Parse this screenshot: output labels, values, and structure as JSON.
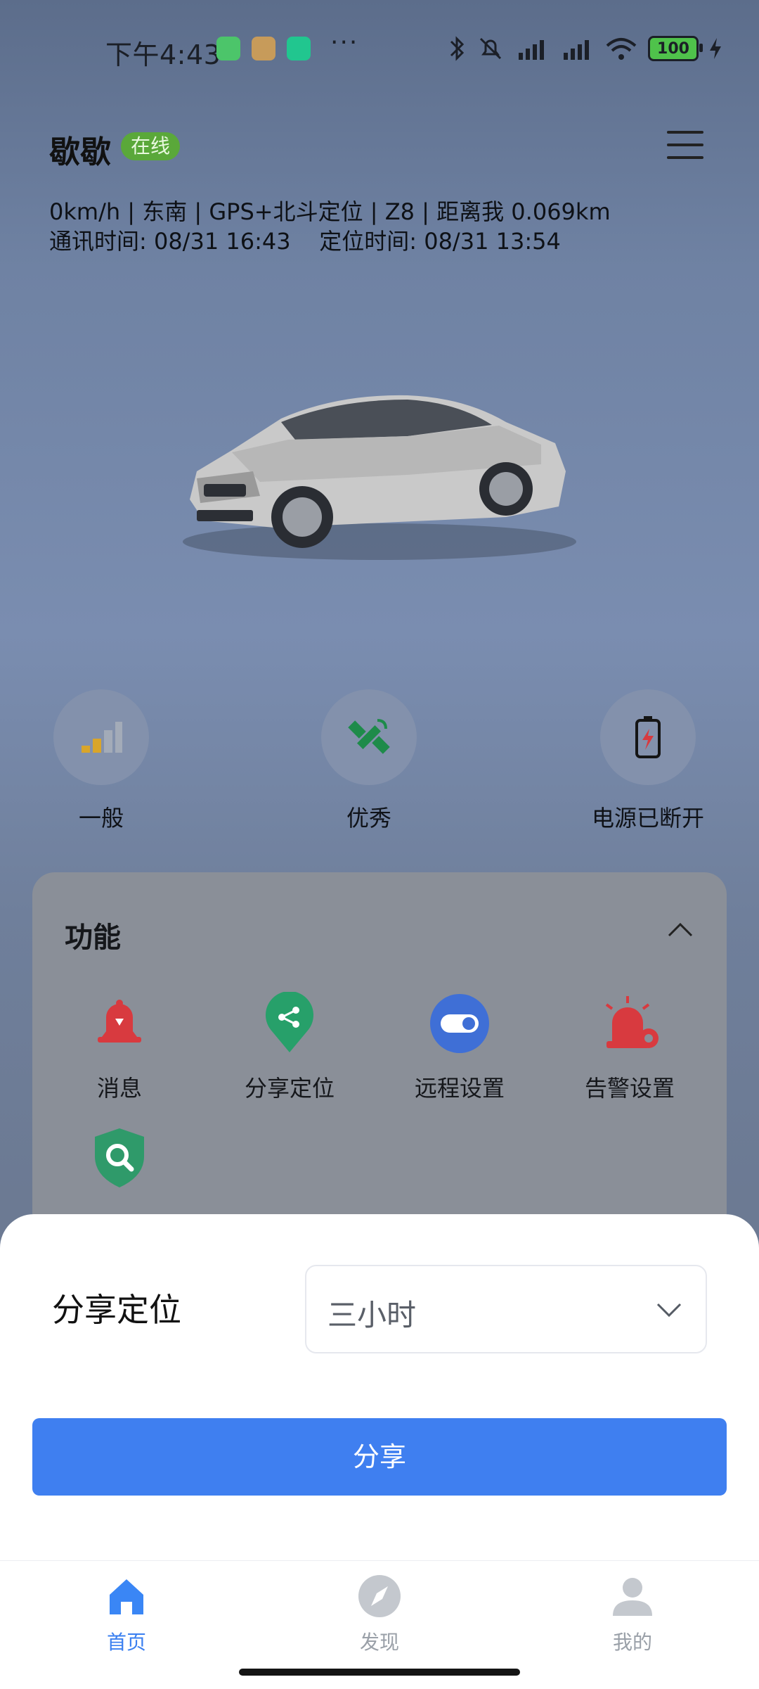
{
  "status_bar": {
    "time": "下午4:43",
    "dots": "···",
    "battery": "100"
  },
  "header": {
    "device_name": "歇歇",
    "status_badge": "在线",
    "info_line1": "0km/h | 东南 | GPS+北斗定位 | Z8 | 距离我 0.069km",
    "info_line2": "通讯时间: 08/31 16:43    定位时间: 08/31 13:54"
  },
  "stats": [
    {
      "label": "一般",
      "icon": "signal-bars-icon"
    },
    {
      "label": "优秀",
      "icon": "satellite-icon"
    },
    {
      "label": "电源已断开",
      "icon": "battery-disconnected-icon"
    }
  ],
  "functions": {
    "title": "功能",
    "items": [
      {
        "label": "消息",
        "icon": "bell-icon",
        "color": "#d83a3f"
      },
      {
        "label": "分享定位",
        "icon": "share-location-icon",
        "color": "#27a06a"
      },
      {
        "label": "远程设置",
        "icon": "toggle-icon",
        "color": "#3f6fd6"
      },
      {
        "label": "告警设置",
        "icon": "alarm-settings-icon",
        "color": "#d83a3f"
      },
      {
        "label": "",
        "icon": "shield-search-icon",
        "color": "#2f9a6a"
      }
    ]
  },
  "share_sheet": {
    "title": "分享定位",
    "duration_value": "三小时",
    "share_button": "分享"
  },
  "tabs": [
    {
      "label": "首页",
      "active": true,
      "icon": "home-icon"
    },
    {
      "label": "发现",
      "active": false,
      "icon": "compass-icon"
    },
    {
      "label": "我的",
      "active": false,
      "icon": "user-icon"
    }
  ],
  "colors": {
    "primary": "#3f7ff0",
    "online_badge": "#5aa83a"
  }
}
